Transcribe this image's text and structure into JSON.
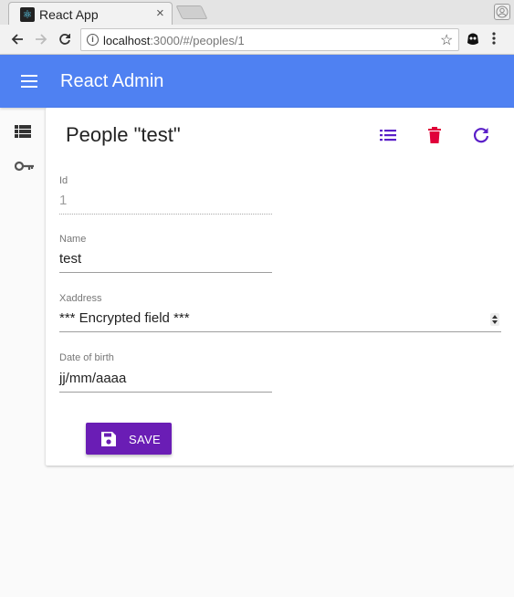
{
  "browser": {
    "tab_title": "React App",
    "tab_close": "×",
    "url_host": "localhost",
    "url_rest": ":3000/#/peoples/1"
  },
  "icons": {
    "favicon": "react-logo-icon",
    "back": "arrow-left-icon",
    "forward": "arrow-right-icon",
    "reload": "reload-icon",
    "info": "info-icon",
    "bookmark": "star-icon",
    "extension": "extension-icon",
    "menu": "more-vert-icon",
    "profile": "profile-icon",
    "hamburger": "menu-icon",
    "people_list": "view-list-icon",
    "keys": "key-icon",
    "list": "list-icon",
    "delete": "trash-icon",
    "refresh": "refresh-icon",
    "save": "floppy-disk-icon"
  },
  "colors": {
    "appbar": "#4f81f2",
    "primary": "#6a1db5",
    "delete": "#e0003a"
  },
  "app": {
    "title": "React Admin"
  },
  "page": {
    "title": "People \"test\""
  },
  "form": {
    "id_label": "Id",
    "id_value": "1",
    "name_label": "Name",
    "name_value": "test",
    "xaddress_label": "Xaddress",
    "xaddress_value": "*** Encrypted field ***",
    "dob_label": "Date of birth",
    "dob_placeholder": "jj/mm/aaaa",
    "save_label": "SAVE"
  }
}
